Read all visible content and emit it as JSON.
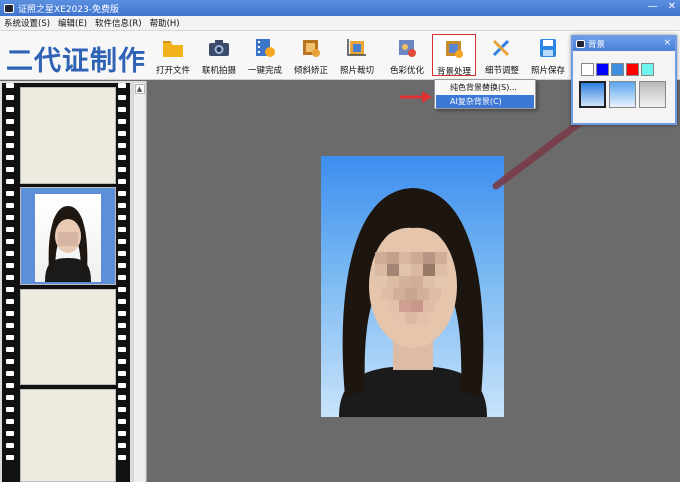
{
  "window": {
    "title": "证照之星XE2023-免费版",
    "minimize": "—",
    "close": "✕"
  },
  "menu": [
    "系统设置(S)",
    "编辑(E)",
    "软件信息(R)",
    "帮助(H)"
  ],
  "brand": "二代证制作",
  "toolbar": [
    {
      "label": "打开文件",
      "icon": "folder-icon",
      "color": "#f2b21c"
    },
    {
      "label": "联机拍摄",
      "icon": "camera-icon",
      "color": "#3d4b6a"
    },
    {
      "label": "一键完成",
      "icon": "film-star-icon",
      "color": "#3c74c9"
    },
    {
      "label": "倾斜矫正",
      "icon": "rotate-photo-icon",
      "color": "#b8741e"
    },
    {
      "label": "照片裁切",
      "icon": "crop-icon",
      "color": "#d18a27"
    },
    {
      "label": "色彩优化",
      "icon": "palette-icon",
      "color": "#6a87c4"
    },
    {
      "label": "背景处理",
      "icon": "background-icon",
      "color": "#c98b2a"
    },
    {
      "label": "细节调整",
      "icon": "tools-icon",
      "color": "#2d7fe0"
    },
    {
      "label": "照片保存",
      "icon": "save-icon",
      "color": "#2e86e5"
    }
  ],
  "dropdown": {
    "items": [
      "纯色背景替换(S)...",
      "AI复杂背景(C)"
    ],
    "highlighted": 1
  },
  "bg_panel": {
    "title": "背景",
    "close": "×",
    "swatches": [
      "#ffffff",
      "#0000ff",
      "#3f8fe0",
      "#ff0000",
      "#6ff5f0"
    ],
    "gradients": [
      "blue-gradient",
      "light-blue-gradient",
      "gray-gradient"
    ]
  },
  "scroll_up": "▲"
}
